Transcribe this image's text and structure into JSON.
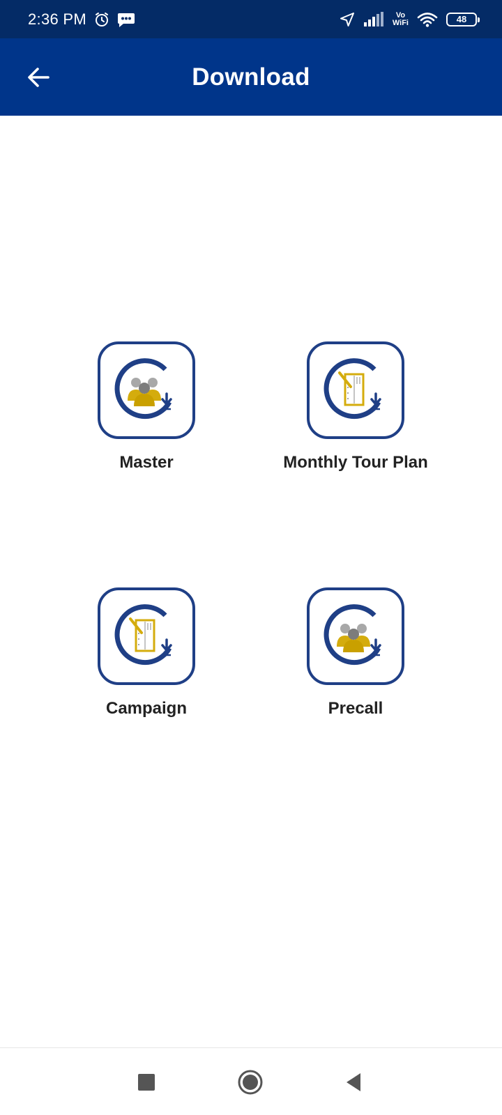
{
  "status_bar": {
    "time": "2:36 PM",
    "vo_label": "Vo",
    "wifi_label": "WiFi",
    "battery_level": "48",
    "icons": [
      "alarm-icon",
      "message-icon",
      "location-icon",
      "signal-icon",
      "wifi-icon",
      "battery-icon"
    ]
  },
  "app_bar": {
    "title": "Download",
    "back_icon": "arrow-left-icon"
  },
  "tiles": [
    {
      "label": "Master",
      "icon": "people-sync-icon"
    },
    {
      "label": "Monthly Tour Plan",
      "icon": "document-sync-icon"
    },
    {
      "label": "Campaign",
      "icon": "document-sync-icon"
    },
    {
      "label": "Precall",
      "icon": "people-sync-icon"
    }
  ],
  "nav_bar": {
    "icons": [
      "recents-icon",
      "home-icon",
      "back-icon"
    ]
  },
  "colors": {
    "status_bar": "#042b66",
    "app_bar": "#00358a",
    "tile_border": "#1f3f86",
    "accent_gold": "#d4ac0d",
    "label_text": "#222222"
  }
}
